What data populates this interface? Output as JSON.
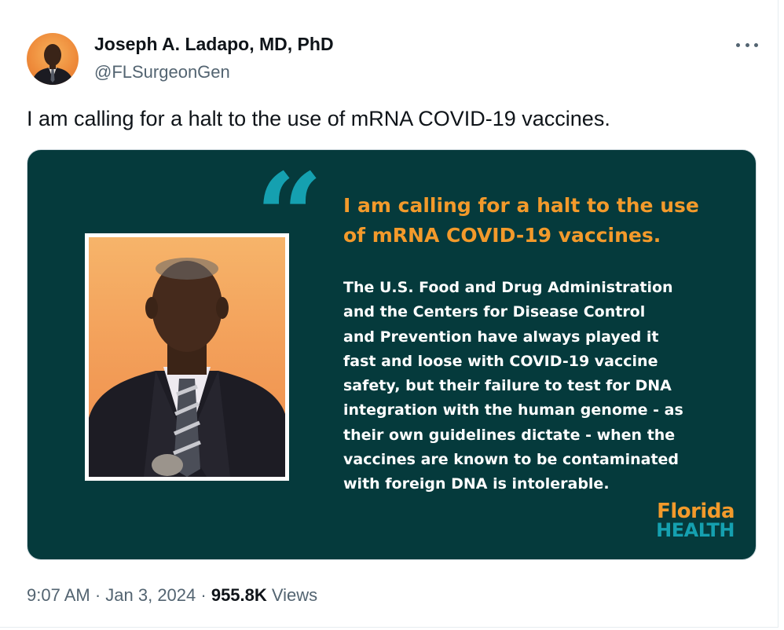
{
  "author": {
    "name": "Joseph A. Ladapo, MD, PhD",
    "handle": "@FLSurgeonGen"
  },
  "tweet": {
    "text": "I am calling for a halt to the use of mRNA COVID-19 vaccines."
  },
  "media": {
    "quote_glyph": "“",
    "headline_lines": [
      "I am calling for a halt to the use",
      "of mRNA COVID-19 vaccines."
    ],
    "body_lines": [
      "The U.S. Food and Drug Administration",
      "and the Centers for Disease Control",
      "and Prevention have always played it",
      "fast and loose with COVID-19 vaccine",
      "safety, but their failure to test for DNA",
      "integration with the human genome - as",
      "their own guidelines dictate - when the",
      "vaccines are known to be contaminated",
      "with foreign DNA is intolerable."
    ],
    "logo_line1": "Florida",
    "logo_line2": "HEALTH",
    "colors": {
      "background": "#053a3c",
      "headline": "#f39a2b",
      "accent": "#15a0b0"
    }
  },
  "meta": {
    "time": "9:07 AM",
    "sep1": " · ",
    "date": "Jan 3, 2024",
    "sep2": " · ",
    "views_count": "955.8K",
    "views_label": " Views"
  },
  "icons": {
    "more": "more-horizontal-icon"
  }
}
